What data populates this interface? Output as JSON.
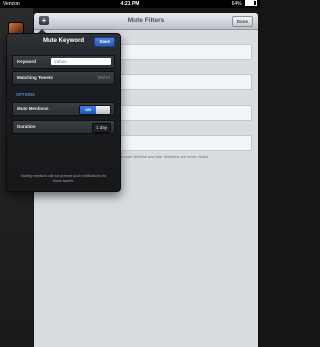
{
  "status_bar": {
    "carrier": "Verizon",
    "time": "4:21 PM",
    "battery": "64%"
  },
  "main": {
    "title": "Mute Filters",
    "add_label": "+",
    "done_label": "Done",
    "note": "your main timeline and lists. Mentions are never muted."
  },
  "popover": {
    "title": "Mute Keyword",
    "save_label": "Save",
    "keyword_label": "Keyword",
    "keyword_value": "Yahoo",
    "matching_label": "Matching Tweets",
    "matching_count": "3/9/14",
    "options_label": "OPTIONS",
    "mute_mentions_label": "Mute Mentions",
    "mute_mentions_state": "ON",
    "duration_label": "Duration",
    "duration_value": "1 day",
    "footer": "Muting mentions will not prevent push notifications for those tweets."
  },
  "colors": {
    "accent": "#2a63c9",
    "section": "#4f86d9"
  },
  "icons": {
    "add": "plus-icon"
  }
}
